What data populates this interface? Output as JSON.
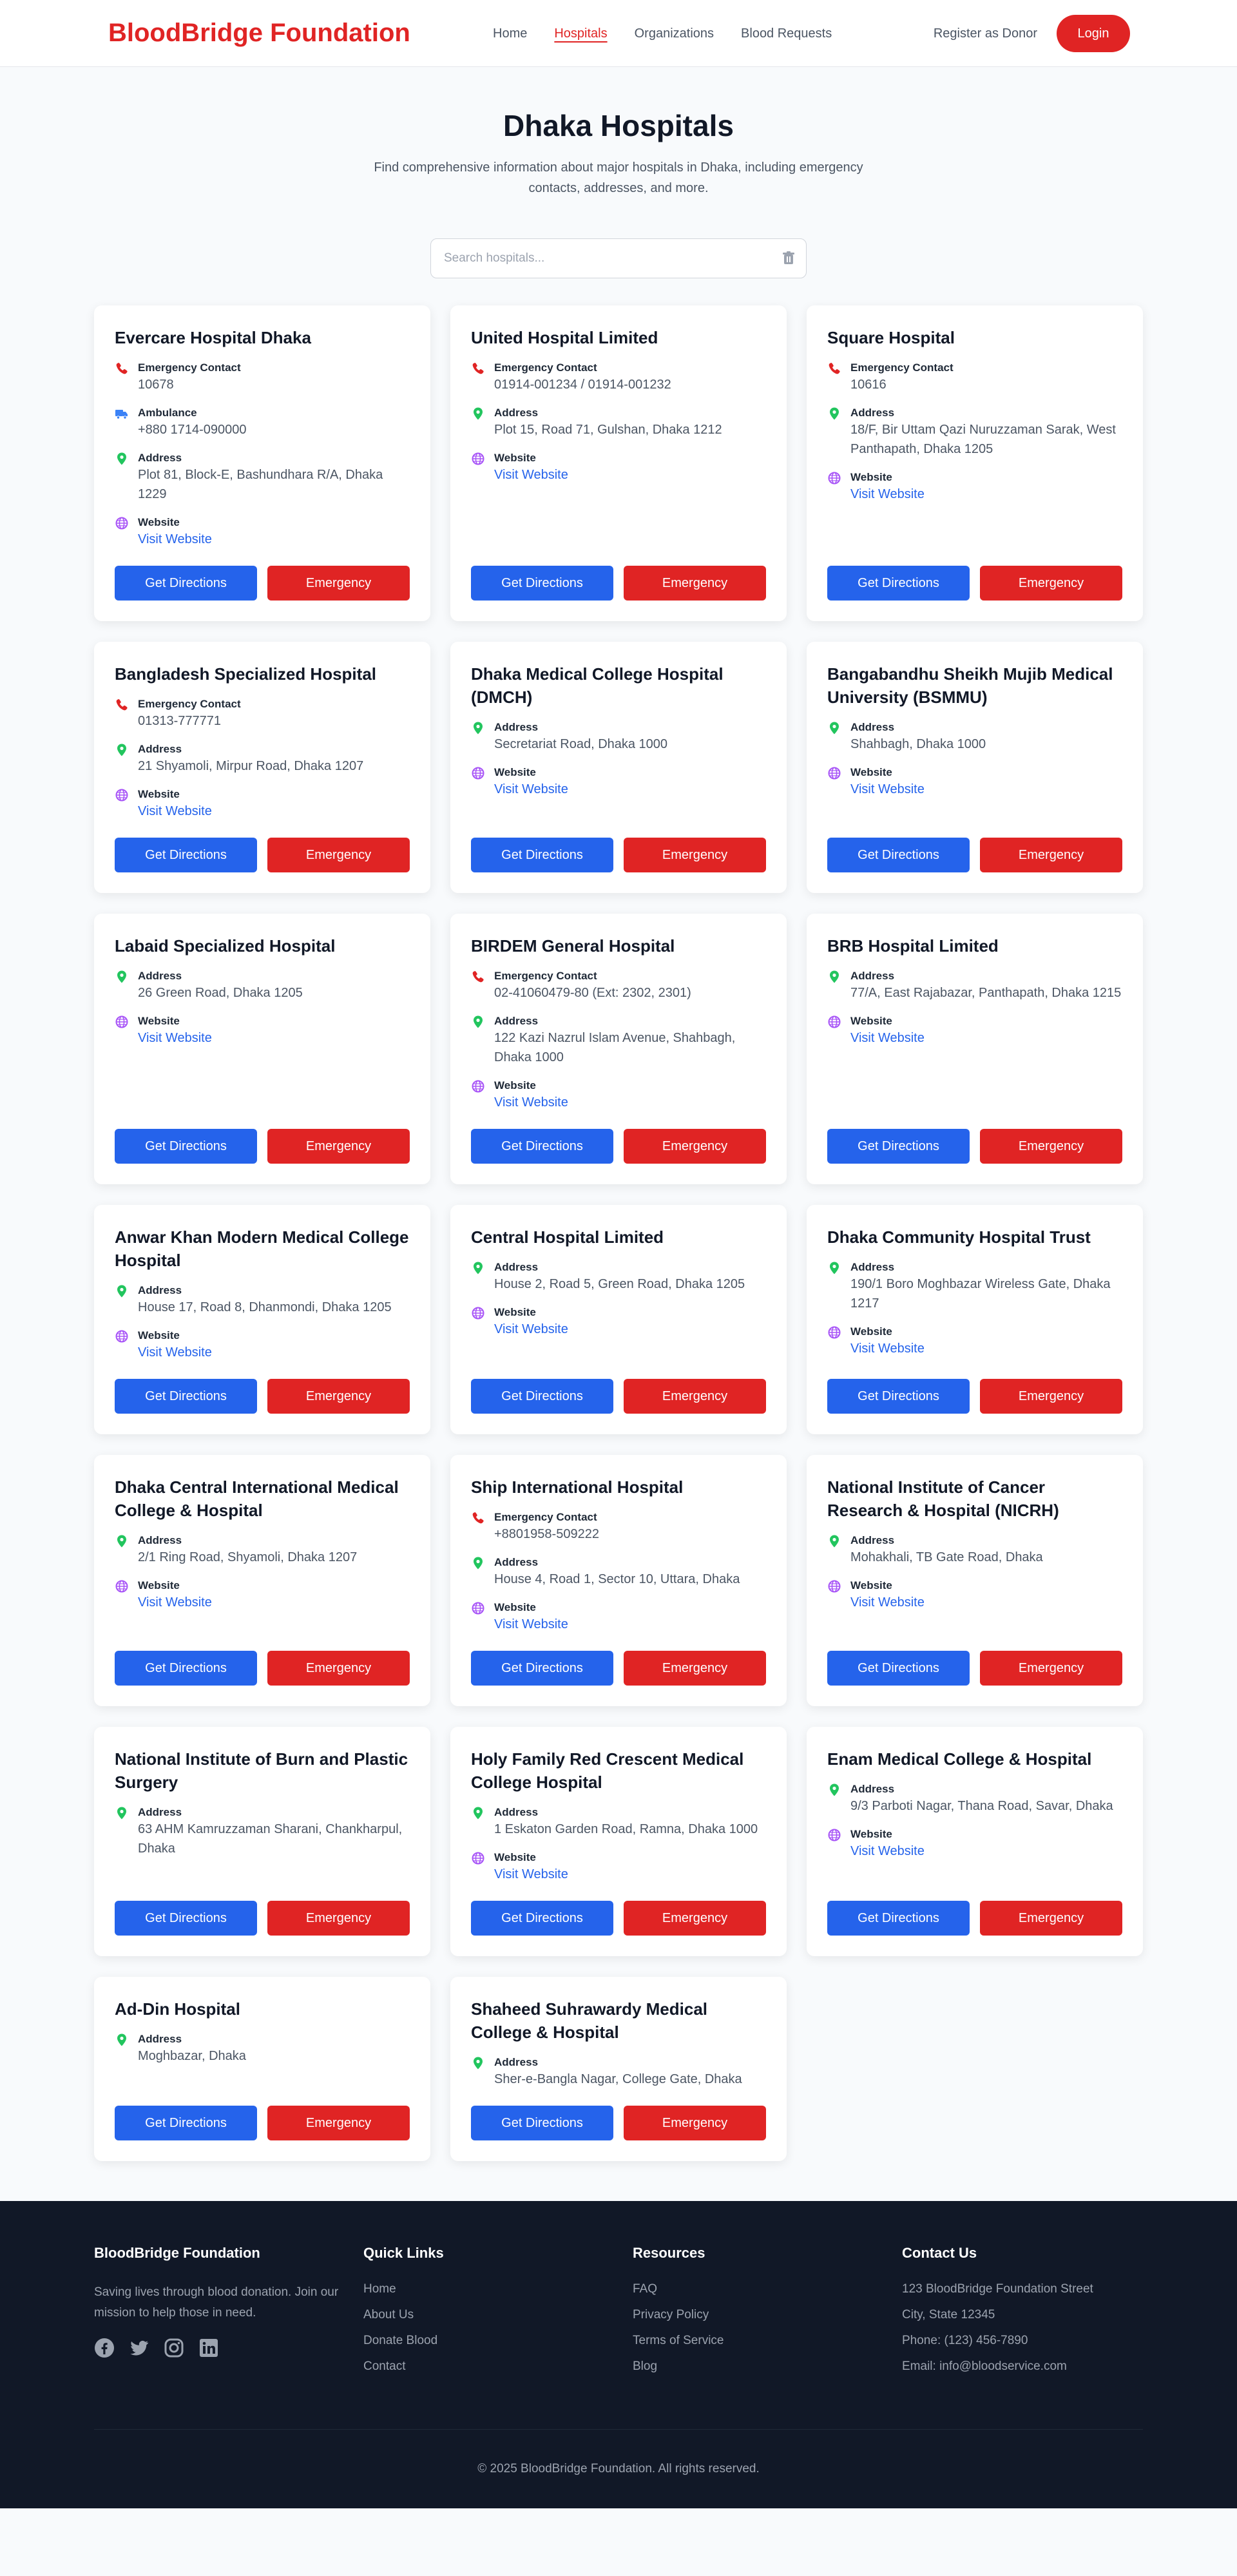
{
  "nav": {
    "brand": "BloodBridge Foundation",
    "links": [
      "Home",
      "Hospitals",
      "Organizations",
      "Blood Requests"
    ],
    "register": "Register as Donor",
    "login": "Login"
  },
  "hero": {
    "title": "Dhaka Hospitals",
    "subtitle": "Find comprehensive information about major hospitals in Dhaka, including emergency contacts, addresses, and more."
  },
  "search": {
    "placeholder": "Search hospitals..."
  },
  "labels": {
    "emergency_contact": "Emergency Contact",
    "ambulance": "Ambulance",
    "address": "Address",
    "website": "Website",
    "visit_website": "Visit Website",
    "directions": "Get Directions",
    "emergency": "Emergency"
  },
  "hospitals": [
    {
      "name": "Evercare Hospital Dhaka",
      "emergency": "10678",
      "ambulance": "+880 1714-090000",
      "address": "Plot 81, Block-E, Bashundhara R/A, Dhaka 1229",
      "website": true
    },
    {
      "name": "United Hospital Limited",
      "emergency": "01914-001234 / 01914-001232",
      "address": "Plot 15, Road 71, Gulshan, Dhaka 1212",
      "website": true
    },
    {
      "name": "Square Hospital",
      "emergency": "10616",
      "address": "18/F, Bir Uttam Qazi Nuruzzaman Sarak, West Panthapath, Dhaka 1205",
      "website": true
    },
    {
      "name": "Bangladesh Specialized Hospital",
      "emergency": "01313-777771",
      "address": "21 Shyamoli, Mirpur Road, Dhaka 1207",
      "website": true
    },
    {
      "name": "Dhaka Medical College Hospital (DMCH)",
      "address": "Secretariat Road, Dhaka 1000",
      "website": true
    },
    {
      "name": "Bangabandhu Sheikh Mujib Medical University (BSMMU)",
      "address": "Shahbagh, Dhaka 1000",
      "website": true
    },
    {
      "name": "Labaid Specialized Hospital",
      "address": "26 Green Road, Dhaka 1205",
      "website": true
    },
    {
      "name": "BIRDEM General Hospital",
      "emergency": "02-41060479-80 (Ext: 2302, 2301)",
      "address": "122 Kazi Nazrul Islam Avenue, Shahbagh, Dhaka 1000",
      "website": true
    },
    {
      "name": "BRB Hospital Limited",
      "address": "77/A, East Rajabazar, Panthapath, Dhaka 1215",
      "website": true
    },
    {
      "name": "Anwar Khan Modern Medical College Hospital",
      "address": "House 17, Road 8, Dhanmondi, Dhaka 1205",
      "website": true
    },
    {
      "name": "Central Hospital Limited",
      "address": "House 2, Road 5, Green Road, Dhaka 1205",
      "website": true
    },
    {
      "name": "Dhaka Community Hospital Trust",
      "address": "190/1 Boro Moghbazar Wireless Gate, Dhaka 1217",
      "website": true
    },
    {
      "name": "Dhaka Central International Medical College & Hospital",
      "address": "2/1 Ring Road, Shyamoli, Dhaka 1207",
      "website": true
    },
    {
      "name": "Ship International Hospital",
      "emergency": "+8801958-509222",
      "address": "House 4, Road 1, Sector 10, Uttara, Dhaka",
      "website": true
    },
    {
      "name": "National Institute of Cancer Research & Hospital (NICRH)",
      "address": "Mohakhali, TB Gate Road, Dhaka",
      "website": true
    },
    {
      "name": "National Institute of Burn and Plastic Surgery",
      "address": "63 AHM Kamruzzaman Sharani, Chankharpul, Dhaka",
      "website": false
    },
    {
      "name": "Holy Family Red Crescent Medical College Hospital",
      "address": "1 Eskaton Garden Road, Ramna, Dhaka 1000",
      "website": true
    },
    {
      "name": "Enam Medical College & Hospital",
      "address": "9/3 Parboti Nagar, Thana Road, Savar, Dhaka",
      "website": true
    },
    {
      "name": "Ad-Din Hospital",
      "address": "Moghbazar, Dhaka",
      "website": false
    },
    {
      "name": "Shaheed Suhrawardy Medical College & Hospital",
      "address": "Sher-e-Bangla Nagar, College Gate, Dhaka",
      "website": false
    }
  ],
  "footer": {
    "about_title": "BloodBridge Foundation",
    "about_text": "Saving lives through blood donation. Join our mission to help those in need.",
    "quick_title": "Quick Links",
    "quick_links": [
      "Home",
      "About Us",
      "Donate Blood",
      "Contact"
    ],
    "resources_title": "Resources",
    "resources": [
      "FAQ",
      "Privacy Policy",
      "Terms of Service",
      "Blog"
    ],
    "contact_title": "Contact Us",
    "contact": [
      "123 BloodBridge Foundation Street",
      "City, State 12345",
      "Phone: (123) 456-7890",
      "Email: info@bloodservice.com"
    ],
    "copyright": "© 2025 BloodBridge Foundation. All rights reserved."
  },
  "colors": {
    "brand": "#e02424",
    "primary": "#2563eb",
    "address_icon": "#22c55e",
    "website_icon": "#a855f7",
    "ambulance_icon": "#3b82f6"
  }
}
